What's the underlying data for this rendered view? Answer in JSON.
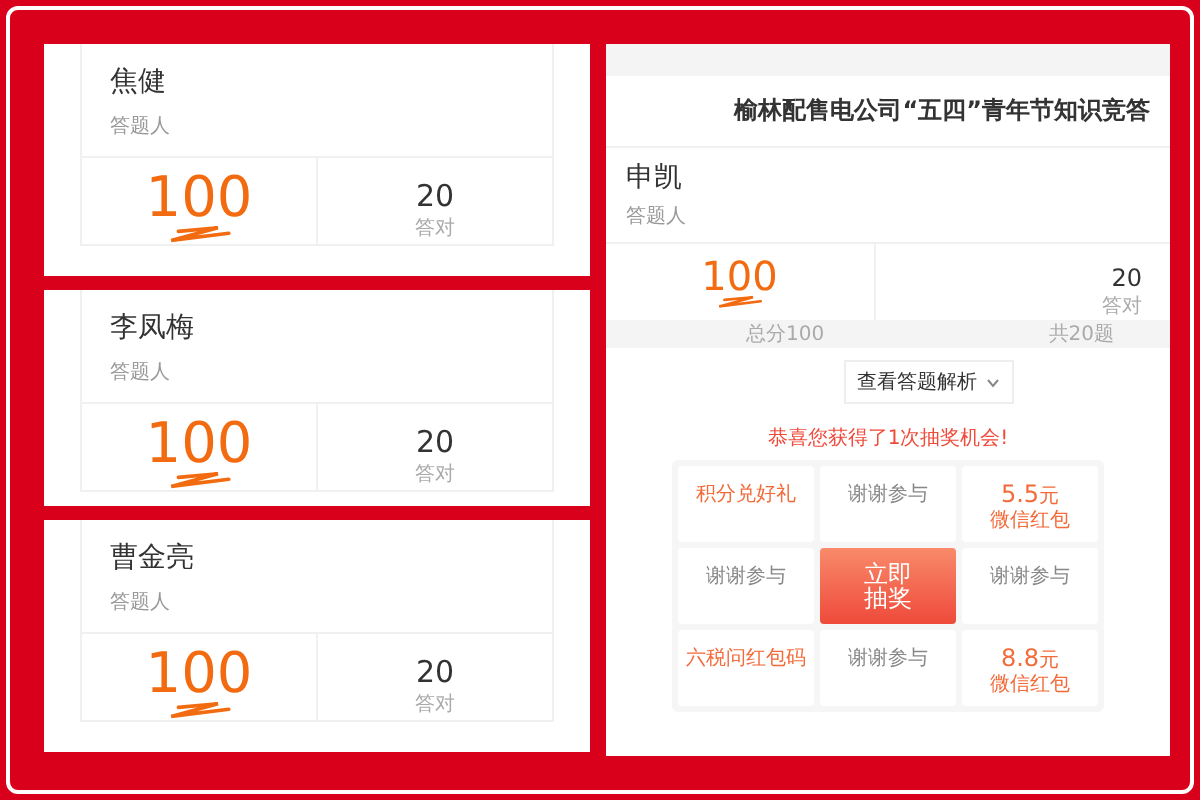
{
  "left_panels": [
    {
      "name": "焦健",
      "role": "答题人",
      "score": "100",
      "correct": "20",
      "correct_label": "答对"
    },
    {
      "name": "李凤梅",
      "role": "答题人",
      "score": "100",
      "correct": "20",
      "correct_label": "答对"
    },
    {
      "name": "曹金亮",
      "role": "答题人",
      "score": "100",
      "correct": "20",
      "correct_label": "答对"
    }
  ],
  "right_panel": {
    "title": "榆林配售电公司“五四”青年节知识竞答",
    "name": "申凯",
    "role": "答题人",
    "score": "100",
    "correct": "20",
    "correct_label": "答对",
    "total_label": "总分100",
    "count_label": "共20题",
    "analysis_button": "查看答题解析",
    "prize_heading": "恭喜您获得了1次抽奖机会!",
    "prizes": [
      {
        "kind": "gift",
        "label": "积分兑好礼"
      },
      {
        "kind": "thanks",
        "label": "谢谢参与"
      },
      {
        "kind": "cash",
        "amount": "5.5",
        "unit": "元",
        "label": "微信红包"
      },
      {
        "kind": "thanks",
        "label": "谢谢参与"
      },
      {
        "kind": "draw",
        "label": "立即抽奖"
      },
      {
        "kind": "thanks",
        "label": "谢谢参与"
      },
      {
        "kind": "gift",
        "label": "六税问红包码"
      },
      {
        "kind": "thanks",
        "label": "谢谢参与"
      },
      {
        "kind": "cash",
        "amount": "8.8",
        "unit": "元",
        "label": "微信红包"
      }
    ]
  }
}
